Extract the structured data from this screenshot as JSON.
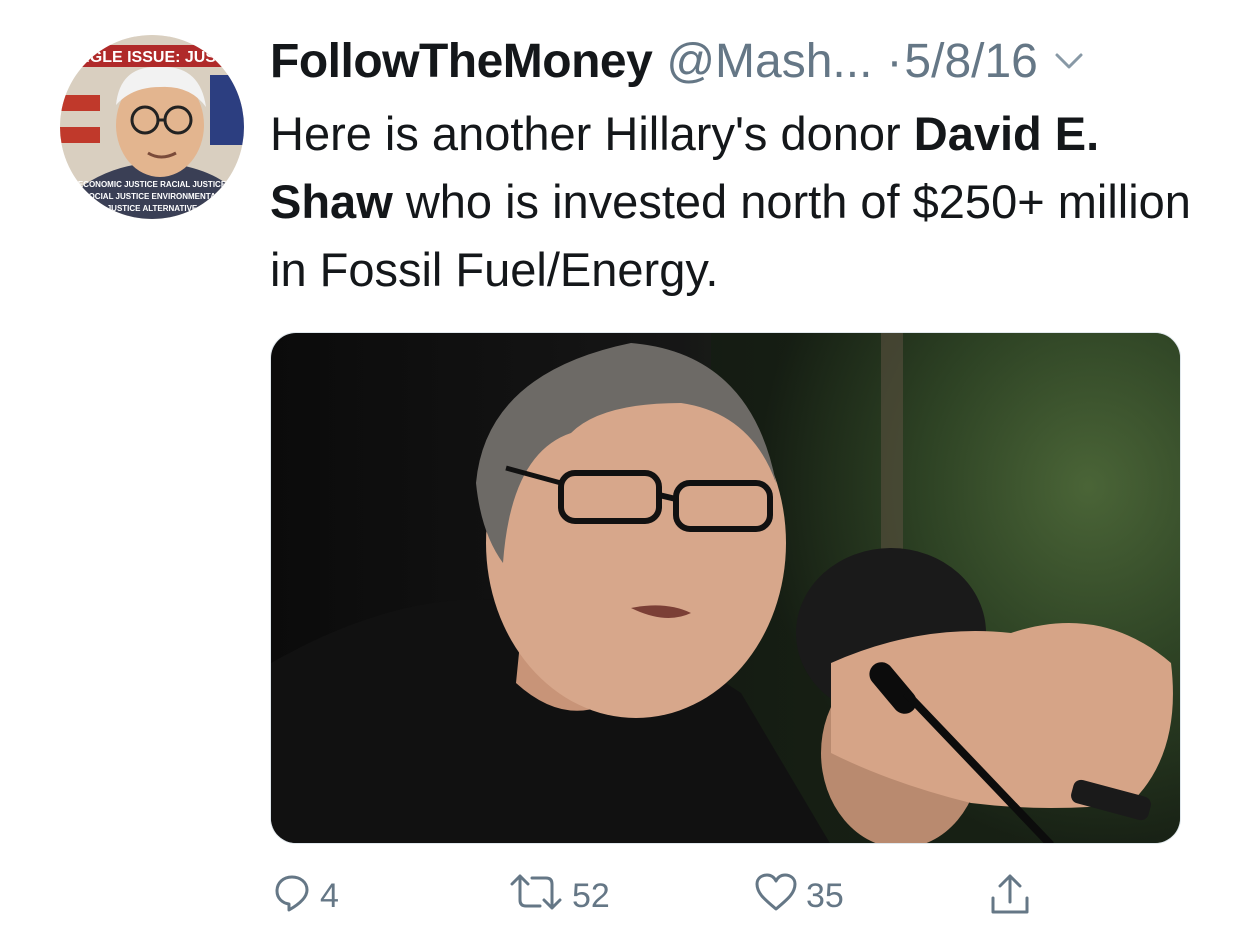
{
  "tweet": {
    "author_name": "FollowTheMoney",
    "author_handle": "@Mash...",
    "separator": "·",
    "date": "5/8/16",
    "text_parts": {
      "p1": "Here is another Hillary's donor ",
      "b1": "David E. Shaw",
      "p2": " who is invested north of $250+ million in Fossil Fuel/Energy."
    }
  },
  "avatar": {
    "banner_text": "NGLE ISSUE: JUST",
    "lines": [
      "ECONOMIC JUSTICE  RACIAL JUSTICE",
      "SOCIAL JUSTICE  ENVIRONMENTAL",
      "JUSTICE  ALTERNATIVE"
    ]
  },
  "actions": {
    "reply": {
      "icon": "reply-icon",
      "count": "4"
    },
    "retweet": {
      "icon": "retweet-icon",
      "count": "52"
    },
    "like": {
      "icon": "heart-icon",
      "count": "35"
    },
    "share": {
      "icon": "share-icon"
    }
  },
  "colors": {
    "secondary_text": "#657786",
    "primary_text": "#14171a"
  }
}
